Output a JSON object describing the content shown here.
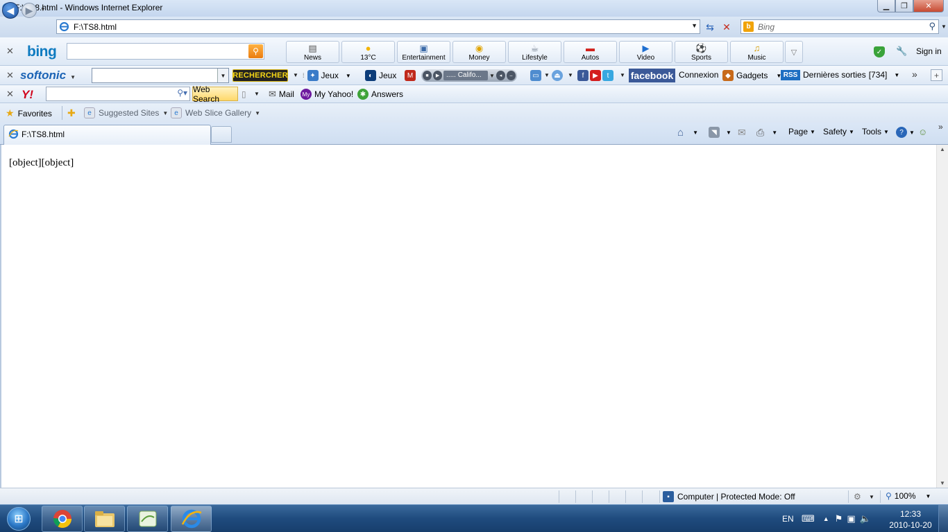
{
  "window": {
    "title": "F:\\TS8.html - Windows Internet Explorer",
    "controls": [
      "minimize",
      "restore",
      "close"
    ]
  },
  "address_bar": {
    "url": "F:\\TS8.html",
    "search_placeholder": "Bing"
  },
  "bing_toolbar": {
    "logo": "bing",
    "search_value": "",
    "tiles": [
      {
        "label": "News",
        "icon": "news-icon"
      },
      {
        "label": "13°C",
        "icon": "sun-icon"
      },
      {
        "label": "Entertainment",
        "icon": "film-icon"
      },
      {
        "label": "Money",
        "icon": "coins-icon"
      },
      {
        "label": "Lifestyle",
        "icon": "cup-icon"
      },
      {
        "label": "Autos",
        "icon": "car-icon"
      },
      {
        "label": "Video",
        "icon": "play-icon"
      },
      {
        "label": "Sports",
        "icon": "ball-icon"
      },
      {
        "label": "Music",
        "icon": "music-icon"
      }
    ],
    "sign_in": "Sign in"
  },
  "softonic_toolbar": {
    "logo": "softonic",
    "search_value": "",
    "search_button": "RECHERCHER",
    "jeux1": "Jeux",
    "jeux2": "Jeux",
    "player_track": "..... Califo...",
    "facebook": "facebook",
    "connexion": "Connexion",
    "gadgets": "Gadgets",
    "rss_badge": "RSS",
    "dernieres": "Dernières sorties",
    "dernieres_count": "[734]"
  },
  "yahoo_toolbar": {
    "logo": "Y!",
    "search_value": "",
    "web_search": "Web Search",
    "mail": "Mail",
    "my_yahoo": "My Yahoo!",
    "answers": "Answers"
  },
  "favorites_bar": {
    "favorites": "Favorites",
    "suggested_sites": "Suggested Sites",
    "web_slice_gallery": "Web Slice Gallery"
  },
  "tabs": [
    {
      "title": "F:\\TS8.html",
      "active": true
    }
  ],
  "command_bar": {
    "page": "Page",
    "safety": "Safety",
    "tools": "Tools"
  },
  "content": {
    "text": "[object][object]"
  },
  "status_bar": {
    "zone": "Computer | Protected Mode: Off",
    "zoom": "100%"
  },
  "taskbar": {
    "language": "EN",
    "time": "12:33",
    "date": "2010-10-20",
    "pinned": [
      "chrome-icon",
      "explorer-folder-icon",
      "app-icon",
      "internet-explorer-icon"
    ]
  },
  "colors": {
    "facebook": "#3b5998",
    "bing": "#0f7bc0",
    "yahoo": "#d0021b",
    "softonic": "#1b63b5"
  }
}
